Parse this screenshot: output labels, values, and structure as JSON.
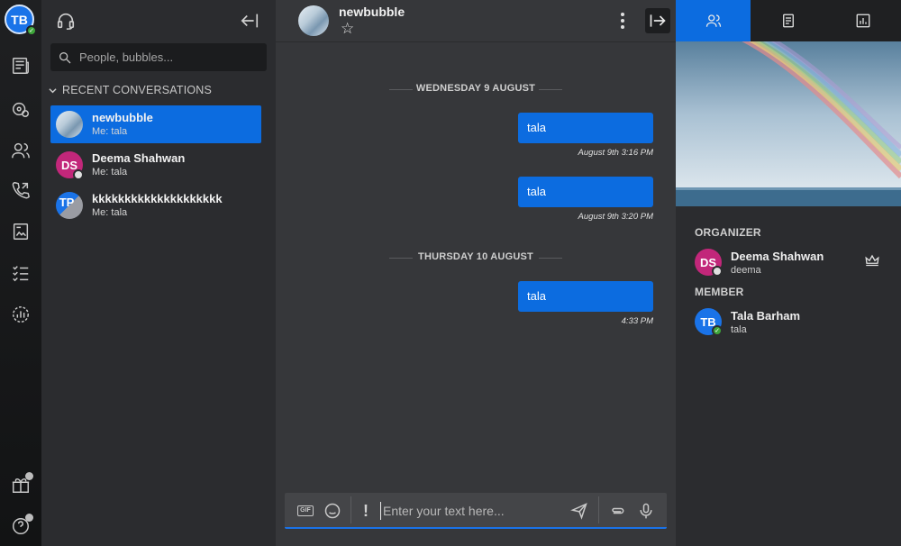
{
  "rail": {
    "me_initials": "TB",
    "icons": [
      "news-icon",
      "channels-icon",
      "contacts-icon",
      "calls-icon",
      "files-icon",
      "tasks-icon",
      "dashboard-icon",
      "gift-icon",
      "help-icon"
    ]
  },
  "list": {
    "search_placeholder": "People, bubbles...",
    "section_title": "RECENT CONVERSATIONS",
    "conversations": [
      {
        "name": "newbubble",
        "last": "Me: tala",
        "initials": ""
      },
      {
        "name": "Deema Shahwan",
        "last": "Me: tala",
        "initials": "DS"
      },
      {
        "name": "kkkkkkkkkkkkkkkkkkkk",
        "last": "Me: tala",
        "initials": "TP"
      }
    ]
  },
  "chat": {
    "title": "newbubble",
    "star": "☆",
    "days": [
      "WEDNESDAY 9 AUGUST",
      "THURSDAY 10 AUGUST"
    ],
    "messages": [
      {
        "text": "tala",
        "time": "August 9th 3:16 PM"
      },
      {
        "text": "tala",
        "time": "August 9th 3:20 PM"
      },
      {
        "text": "tala",
        "time": "4:33 PM"
      }
    ],
    "composer_placeholder": "Enter your text here...",
    "gif_label": "GIF",
    "urgent_label": "!"
  },
  "details": {
    "organizer_label": "ORGANIZER",
    "member_label": "MEMBER",
    "organizer": {
      "initials": "DS",
      "name": "Deema Shahwan",
      "username": "deema"
    },
    "member": {
      "initials": "TB",
      "name": "Tala Barham",
      "username": "tala"
    }
  },
  "colors": {
    "accent": "#0c6ce0",
    "online": "#3ea63a",
    "deema_avatar": "#c2277a"
  }
}
